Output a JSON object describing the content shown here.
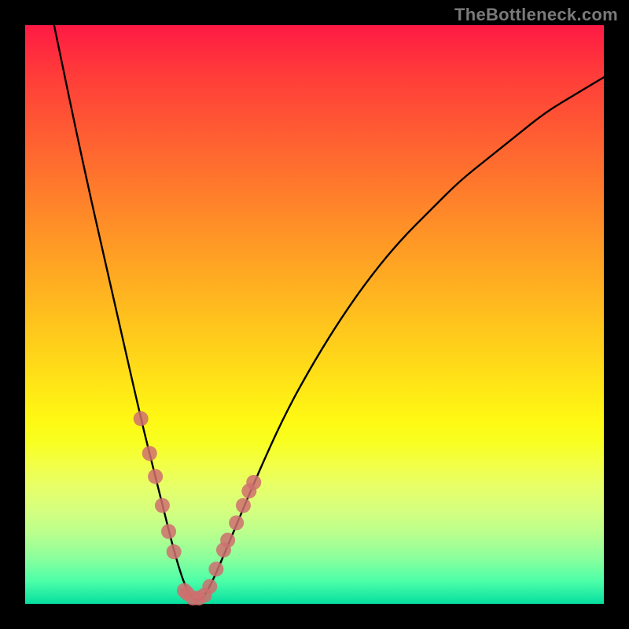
{
  "watermark_text": "TheBottleneck.com",
  "colors": {
    "frame": "#000000",
    "curve": "#000000",
    "dot": "#cf6f6f"
  },
  "chart_data": {
    "type": "line",
    "title": "",
    "xlabel": "",
    "ylabel": "",
    "xlim": [
      0,
      100
    ],
    "ylim": [
      0,
      100
    ],
    "grid": false,
    "legend": false,
    "series": [
      {
        "name": "bottleneck-curve",
        "x": [
          5,
          10,
          15,
          20,
          22,
          24,
          26,
          28,
          30,
          32,
          35,
          40,
          45,
          50,
          55,
          60,
          65,
          70,
          75,
          80,
          85,
          90,
          95,
          100
        ],
        "y": [
          100,
          76,
          54,
          32,
          24,
          16,
          8,
          2,
          0,
          3,
          10,
          22,
          33,
          42,
          50,
          57,
          63,
          68,
          73,
          77,
          81,
          85,
          88,
          91
        ]
      }
    ],
    "marker_points": {
      "name": "highlighted-points",
      "x": [
        20.0,
        21.5,
        22.5,
        23.7,
        24.8,
        25.7,
        27.5,
        28.0,
        29.0,
        30.0,
        31.0,
        31.9,
        33.0,
        34.3,
        35.0,
        36.5,
        37.7,
        38.7,
        39.5
      ],
      "y": [
        32.0,
        26.0,
        22.0,
        17.0,
        12.5,
        9.0,
        2.3,
        1.8,
        1.0,
        1.0,
        1.5,
        3.0,
        6.0,
        9.3,
        11.0,
        14.0,
        17.0,
        19.5,
        21.0
      ]
    }
  }
}
